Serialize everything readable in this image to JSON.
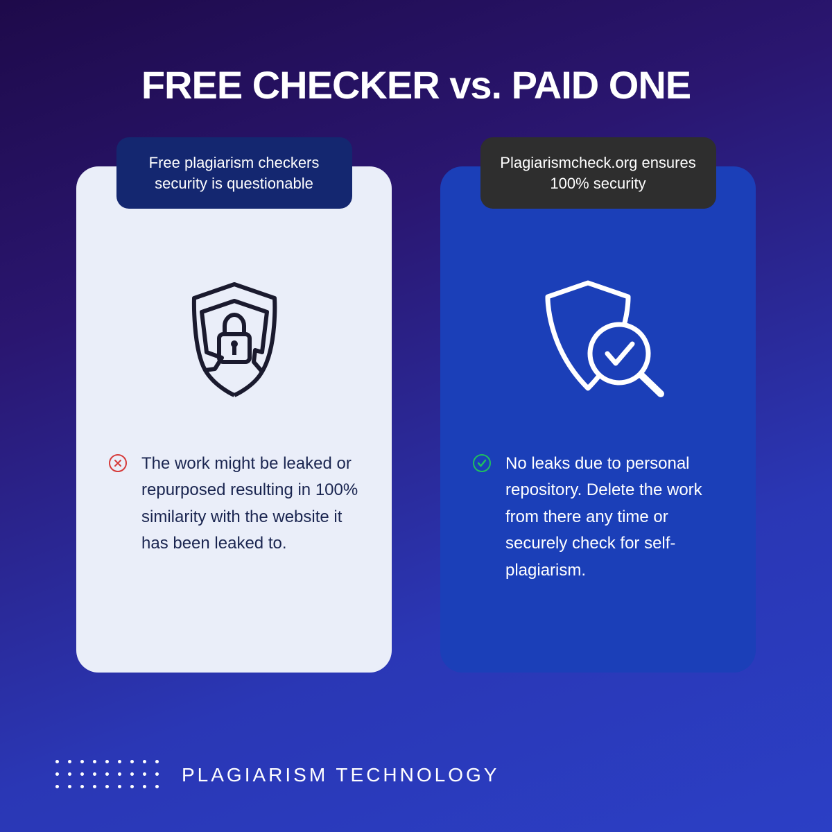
{
  "title": "FREE CHECKER vs. PAID ONE",
  "left": {
    "badge": "Free plagiarism checkers security is questionable",
    "description": "The work might be leaked or repurposed resulting in 100% similarity with the website it has been leaked to."
  },
  "right": {
    "badge": "Plagiarismcheck.org ensures 100% security",
    "description": "No leaks due to personal repository. Delete the work from there any time or securely check for self-plagiarism."
  },
  "footer": "PLAGIARISM TECHNOLOGY"
}
